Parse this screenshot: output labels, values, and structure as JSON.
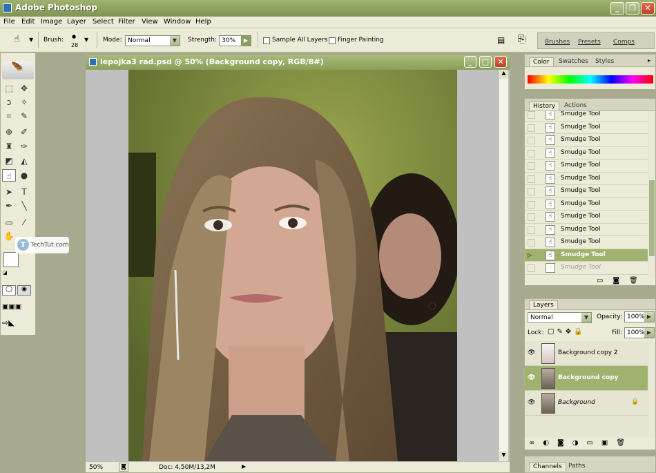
{
  "app": {
    "title": "Adobe Photoshop"
  },
  "menu": [
    "File",
    "Edit",
    "Image",
    "Layer",
    "Select",
    "Filter",
    "View",
    "Window",
    "Help"
  ],
  "options": {
    "brush_label": "Brush:",
    "brush_size": "28",
    "mode_label": "Mode:",
    "mode_value": "Normal",
    "strength_label": "Strength:",
    "strength_value": "30%",
    "sample_all": "Sample All Layers",
    "finger": "Finger Painting"
  },
  "wells": [
    "Brushes",
    "Presets",
    "Comps"
  ],
  "document": {
    "title": "lepojka3 rad.psd @ 50% (Background copy, RGB/8#)",
    "zoom": "50%",
    "doc_info": "Doc: 4,50M/13,2M"
  },
  "watermark": "TechTut.com",
  "color_panel": {
    "tabs": [
      "Color",
      "Swatches",
      "Styles"
    ]
  },
  "history_panel": {
    "tabs": [
      "History",
      "Actions"
    ],
    "items": [
      "Smudge Tool",
      "Smudge Tool",
      "Smudge Tool",
      "Smudge Tool",
      "Smudge Tool",
      "Smudge Tool",
      "Smudge Tool",
      "Smudge Tool",
      "Smudge Tool",
      "Smudge Tool",
      "Smudge Tool",
      "Smudge Tool",
      "Smudge Tool"
    ]
  },
  "layers_panel": {
    "tab": "Layers",
    "blend": "Normal",
    "opacity_label": "Opacity:",
    "opacity": "100%",
    "lock_label": "Lock:",
    "fill_label": "Fill:",
    "fill": "100%",
    "layers": [
      "Background copy 2",
      "Background copy",
      "Background"
    ]
  },
  "channels_panel": {
    "tabs": [
      "Channels",
      "Paths"
    ]
  },
  "colors": {
    "accent": "#9fb36e",
    "chrome": "#ecebd8"
  }
}
